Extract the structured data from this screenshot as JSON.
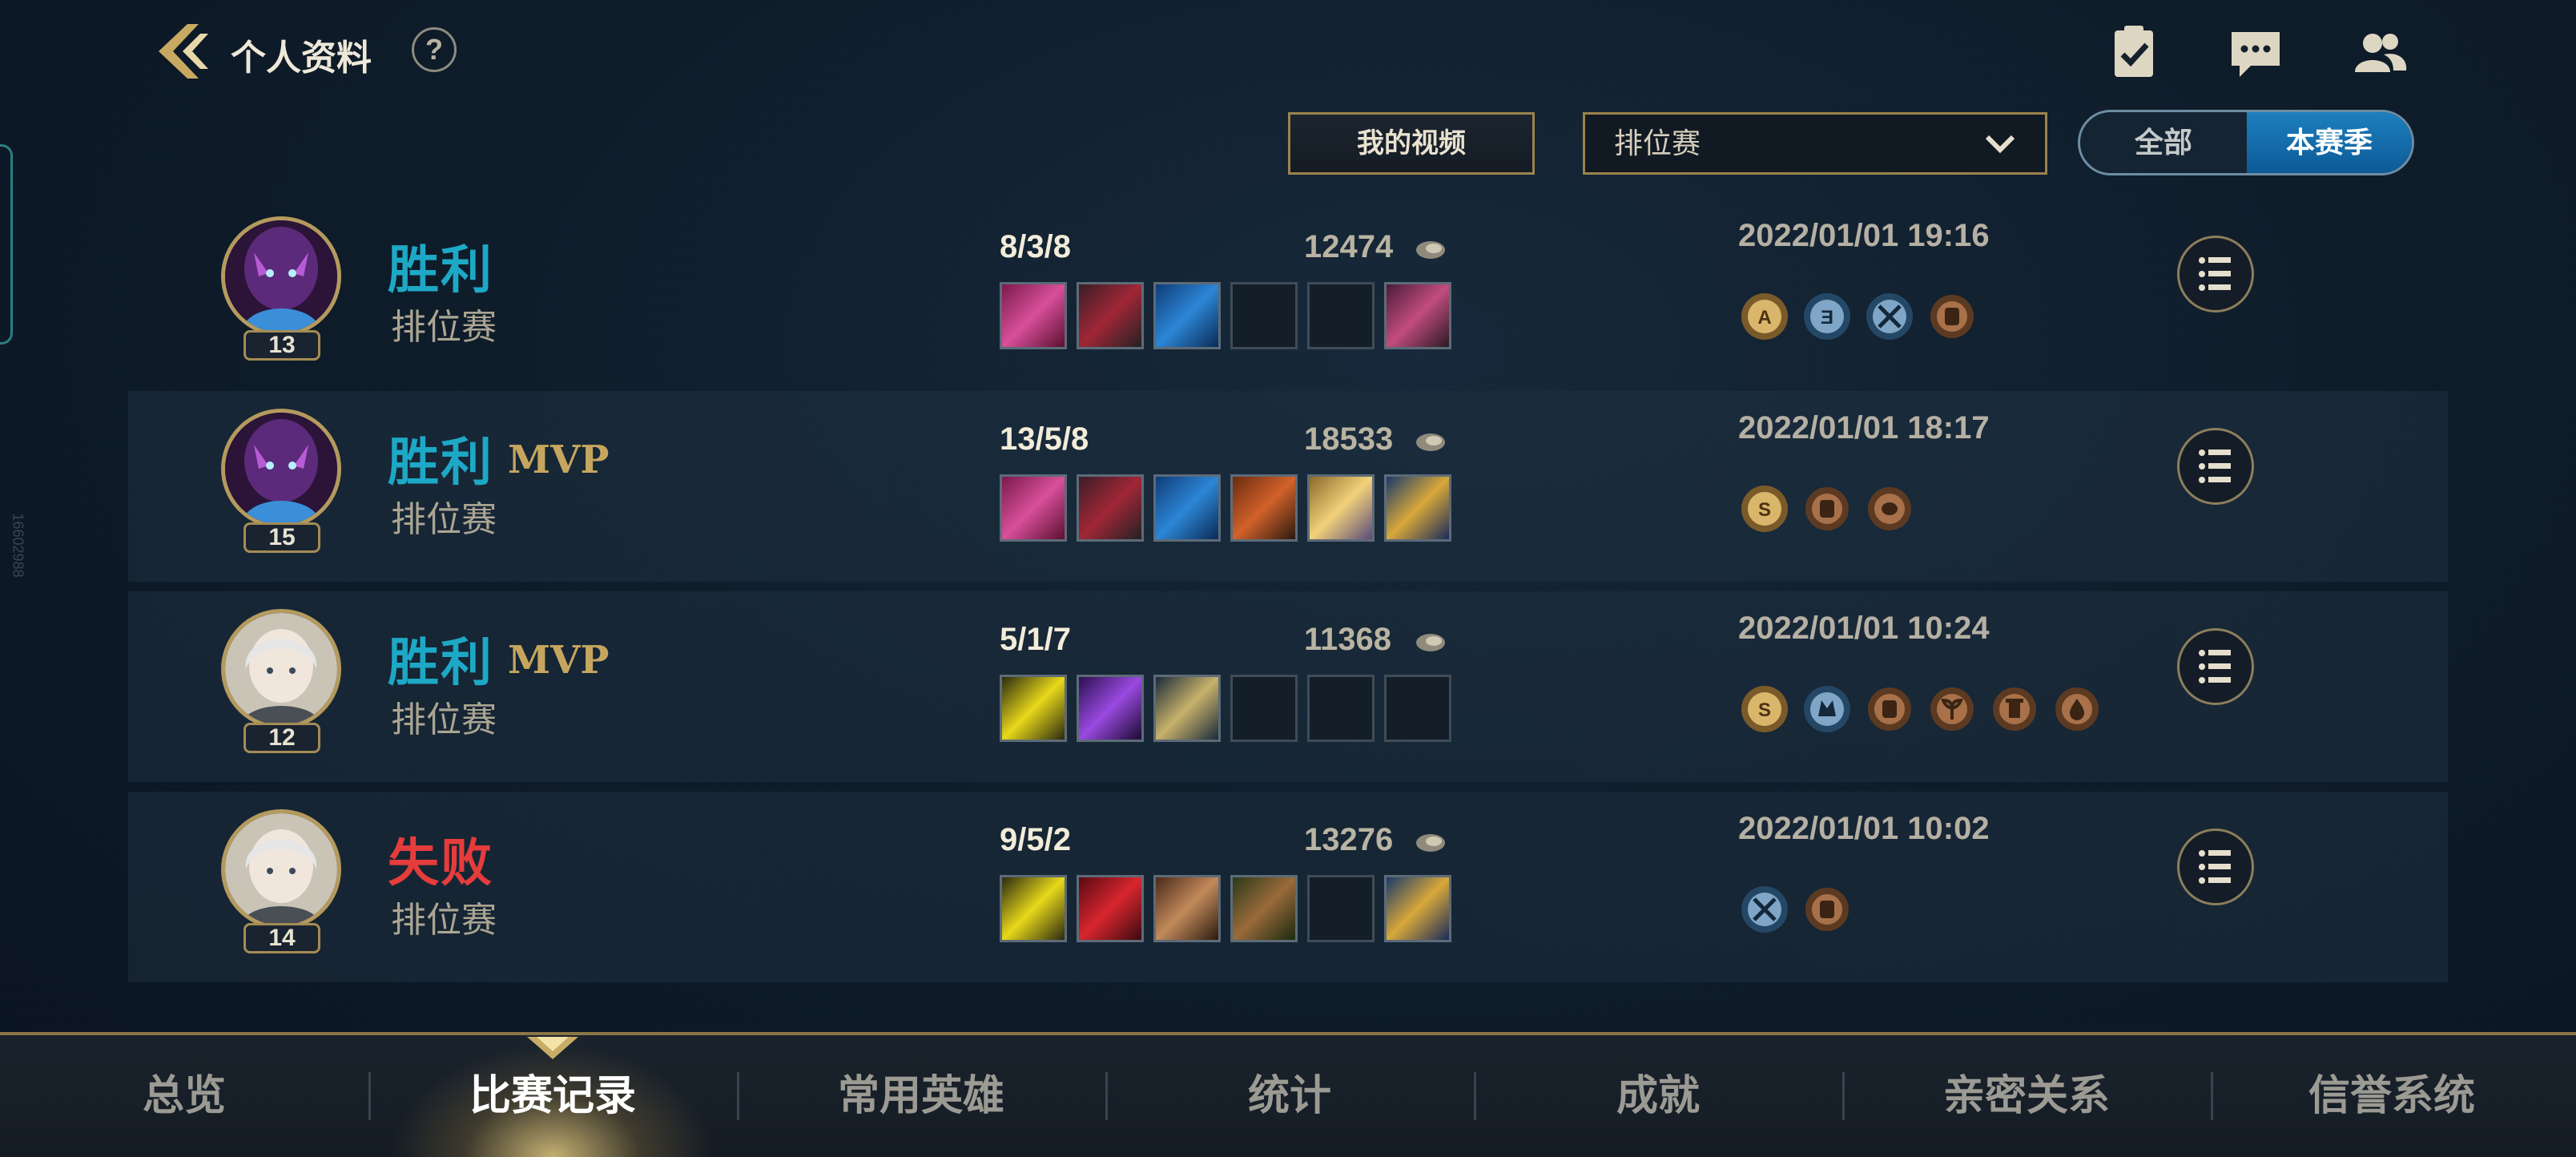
{
  "header": {
    "title": "个人资料",
    "help_label": "?",
    "icons": [
      "back-chevron-icon",
      "help-icon",
      "clipboard-check-icon",
      "chat-icon",
      "friends-icon"
    ]
  },
  "side_text": "16602988",
  "filters": {
    "video_button": "我的视频",
    "mode_select_value": "排位赛",
    "season_toggle": {
      "all": "全部",
      "season": "本赛季",
      "selected": "本赛季"
    }
  },
  "colors": {
    "win": "#1da8c6",
    "loss": "#e53c3c",
    "accent_gold": "#c6a65e",
    "toggle_active": "#1d7fbe"
  },
  "matches": [
    {
      "result": "胜利",
      "mvp": "",
      "mode": "排位赛",
      "level": "13",
      "kda": "8/3/8",
      "gold": "12474",
      "date": "2022/01/01 19:16",
      "medal_count": 4
    },
    {
      "result": "胜利",
      "mvp": "MVP",
      "mode": "排位赛",
      "level": "15",
      "kda": "13/5/8",
      "gold": "18533",
      "date": "2022/01/01 18:17",
      "medal_count": 3
    },
    {
      "result": "胜利",
      "mvp": "MVP",
      "mode": "排位赛",
      "level": "12",
      "kda": "5/1/7",
      "gold": "11368",
      "date": "2022/01/01 10:24",
      "medal_count": 6
    },
    {
      "result": "失败",
      "mvp": "",
      "mode": "排位赛",
      "level": "14",
      "kda": "9/5/2",
      "gold": "13276",
      "date": "2022/01/01 10:02",
      "medal_count": 2
    }
  ],
  "medal_letters": [
    "A",
    "Ǝ",
    "S"
  ],
  "bottom_nav": {
    "tabs": [
      "总览",
      "比赛记录",
      "常用英雄",
      "统计",
      "成就",
      "亲密关系",
      "信誉系统"
    ],
    "active": "比赛记录"
  }
}
